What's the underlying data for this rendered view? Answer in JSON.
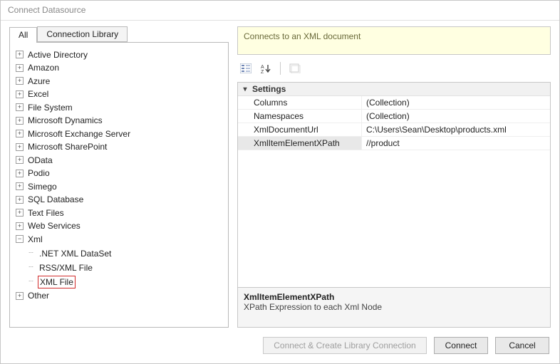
{
  "window": {
    "title": "Connect Datasource"
  },
  "tabs": {
    "all": "All",
    "lib": "Connection Library"
  },
  "tree": {
    "roots": [
      "Active Directory",
      "Amazon",
      "Azure",
      "Excel",
      "File System",
      "Microsoft Dynamics",
      "Microsoft Exchange Server",
      "Microsoft SharePoint",
      "OData",
      "Podio",
      "Simego",
      "SQL Database",
      "Text Files",
      "Web Services"
    ],
    "xml": "Xml",
    "xml_children": [
      ".NET XML DataSet",
      "RSS/XML File",
      "XML File"
    ],
    "other": "Other"
  },
  "info": "Connects to an XML document",
  "propgrid": {
    "category": "Settings",
    "rows": [
      {
        "name": "Columns",
        "value": "(Collection)"
      },
      {
        "name": "Namespaces",
        "value": "(Collection)"
      },
      {
        "name": "XmlDocumentUrl",
        "value": "C:\\Users\\Sean\\Desktop\\products.xml"
      },
      {
        "name": "XmlItemElementXPath",
        "value": "//product"
      }
    ],
    "desc": {
      "title": "XmlItemElementXPath",
      "text": "XPath Expression to each Xml Node"
    }
  },
  "buttons": {
    "cclc": "Connect & Create Library Connection",
    "connect": "Connect",
    "cancel": "Cancel"
  }
}
